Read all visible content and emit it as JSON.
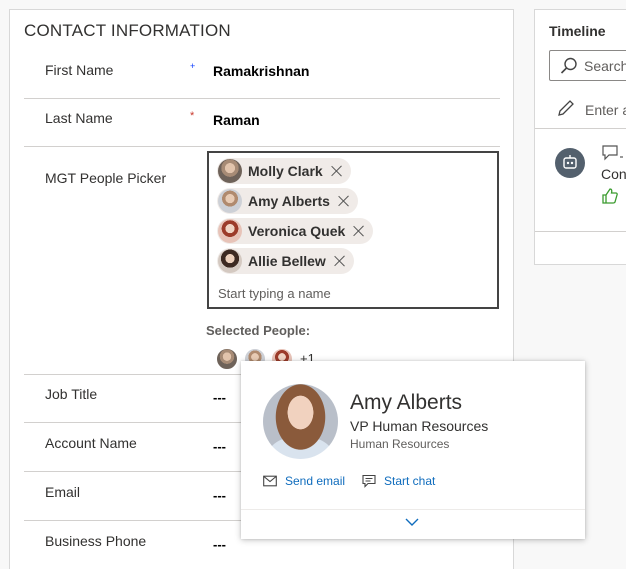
{
  "form": {
    "section_title": "CONTACT INFORMATION",
    "fields": [
      {
        "label": "First Name",
        "required": "+",
        "value": "Ramakrishnan"
      },
      {
        "label": "Last Name",
        "required": "*",
        "value": "Raman"
      },
      {
        "label": "MGT People Picker"
      },
      {
        "label": "Job Title",
        "value": "---"
      },
      {
        "label": "Account Name",
        "value": "---"
      },
      {
        "label": "Email",
        "value": "---"
      },
      {
        "label": "Business Phone",
        "value": "---"
      }
    ]
  },
  "picker": {
    "chips": [
      {
        "name": "Molly Clark"
      },
      {
        "name": "Amy Alberts"
      },
      {
        "name": "Veronica Quek"
      },
      {
        "name": "Allie Bellew"
      }
    ],
    "placeholder": "Start typing a name",
    "selected_label": "Selected People:",
    "overflow": "+1"
  },
  "timeline": {
    "title": "Timeline",
    "search_placeholder": "Search",
    "note_placeholder": "Enter a",
    "entry_text": "Con"
  },
  "card": {
    "name": "Amy Alberts",
    "role": "VP Human Resources",
    "department": "Human Resources",
    "actions": {
      "email": "Send email",
      "chat": "Start chat"
    }
  },
  "colors": {
    "accent": "#0f6cbd",
    "required_red": "#c8372b",
    "recommended_blue": "#0b3bff",
    "chip_bg": "#f0ebe8",
    "timeline_avatar": "#53606d",
    "like_green": "#3a9b2e"
  },
  "icons": {
    "remove": "close-icon",
    "search": "search-icon",
    "note": "pencil-icon",
    "email": "mail-icon",
    "chat": "chat-icon",
    "expand": "chevron-down-icon",
    "like": "thumbs-up-icon",
    "post": "post-icon",
    "bot": "bot-icon"
  }
}
